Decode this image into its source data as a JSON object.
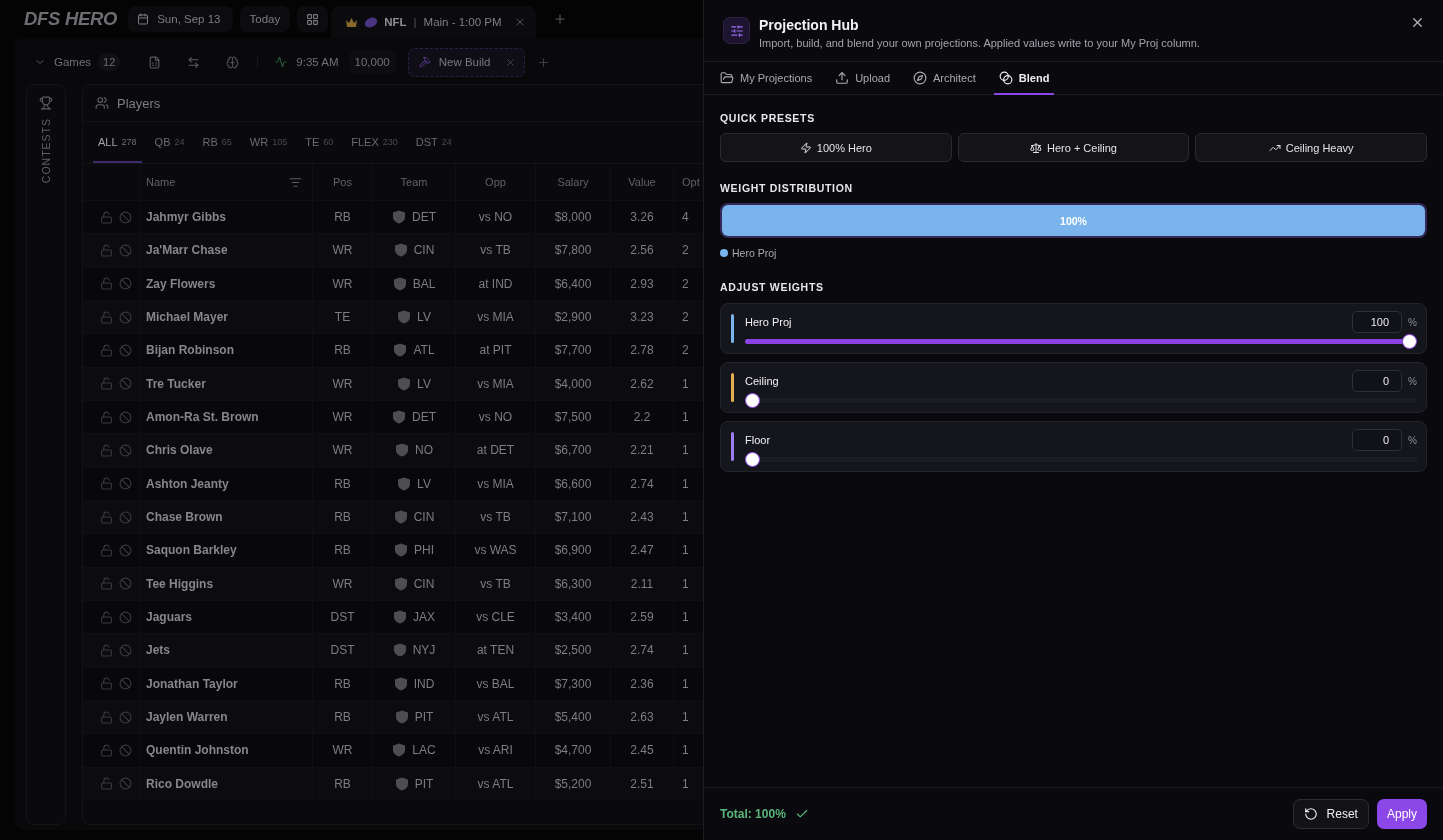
{
  "app_bar": {
    "logo": "DFS HERO",
    "date": "Sun, Sep 13",
    "today_button": "Today",
    "slate_tab": {
      "sport": "NFL",
      "separator": "|",
      "slate": "Main - 1:00 PM"
    }
  },
  "toolbar": {
    "games": {
      "label": "Games",
      "count": "12"
    },
    "time": "9:35 AM",
    "entries": "10,000",
    "build_tab": "New Build"
  },
  "sidebar": {
    "label": "CONTESTS"
  },
  "players": {
    "title": "Players",
    "position_tabs": [
      {
        "label": "ALL",
        "count": "278",
        "selected": true
      },
      {
        "label": "QB",
        "count": "24",
        "selected": false
      },
      {
        "label": "RB",
        "count": "65",
        "selected": false
      },
      {
        "label": "WR",
        "count": "105",
        "selected": false
      },
      {
        "label": "TE",
        "count": "60",
        "selected": false
      },
      {
        "label": "FLEX",
        "count": "230",
        "selected": false
      },
      {
        "label": "DST",
        "count": "24",
        "selected": false
      }
    ],
    "columns": [
      "Name",
      "Pos",
      "Team",
      "Opp",
      "Salary",
      "Value",
      "Opt"
    ],
    "rows": [
      {
        "name": "Jahmyr Gibbs",
        "pos": "RB",
        "team": "DET",
        "opp": "vs NO",
        "salary": "$8,000",
        "value": "3.26",
        "opt": "4"
      },
      {
        "name": "Ja'Marr Chase",
        "pos": "WR",
        "team": "CIN",
        "opp": "vs TB",
        "salary": "$7,800",
        "value": "2.56",
        "opt": "2"
      },
      {
        "name": "Zay Flowers",
        "pos": "WR",
        "team": "BAL",
        "opp": "at IND",
        "salary": "$6,400",
        "value": "2.93",
        "opt": "2"
      },
      {
        "name": "Michael Mayer",
        "pos": "TE",
        "team": "LV",
        "opp": "vs MIA",
        "salary": "$2,900",
        "value": "3.23",
        "opt": "2"
      },
      {
        "name": "Bijan Robinson",
        "pos": "RB",
        "team": "ATL",
        "opp": "at PIT",
        "salary": "$7,700",
        "value": "2.78",
        "opt": "2"
      },
      {
        "name": "Tre Tucker",
        "pos": "WR",
        "team": "LV",
        "opp": "vs MIA",
        "salary": "$4,000",
        "value": "2.62",
        "opt": "1"
      },
      {
        "name": "Amon-Ra St. Brown",
        "pos": "WR",
        "team": "DET",
        "opp": "vs NO",
        "salary": "$7,500",
        "value": "2.2",
        "opt": "1"
      },
      {
        "name": "Chris Olave",
        "pos": "WR",
        "team": "NO",
        "opp": "at DET",
        "salary": "$6,700",
        "value": "2.21",
        "opt": "1"
      },
      {
        "name": "Ashton Jeanty",
        "pos": "RB",
        "team": "LV",
        "opp": "vs MIA",
        "salary": "$6,600",
        "value": "2.74",
        "opt": "1"
      },
      {
        "name": "Chase Brown",
        "pos": "RB",
        "team": "CIN",
        "opp": "vs TB",
        "salary": "$7,100",
        "value": "2.43",
        "opt": "1"
      },
      {
        "name": "Saquon Barkley",
        "pos": "RB",
        "team": "PHI",
        "opp": "vs WAS",
        "salary": "$6,900",
        "value": "2.47",
        "opt": "1"
      },
      {
        "name": "Tee Higgins",
        "pos": "WR",
        "team": "CIN",
        "opp": "vs TB",
        "salary": "$6,300",
        "value": "2.11",
        "opt": "1"
      },
      {
        "name": "Jaguars",
        "pos": "DST",
        "team": "JAX",
        "opp": "vs CLE",
        "salary": "$3,400",
        "value": "2.59",
        "opt": "1"
      },
      {
        "name": "Jets",
        "pos": "DST",
        "team": "NYJ",
        "opp": "at TEN",
        "salary": "$2,500",
        "value": "2.74",
        "opt": "1"
      },
      {
        "name": "Jonathan Taylor",
        "pos": "RB",
        "team": "IND",
        "opp": "vs BAL",
        "salary": "$7,300",
        "value": "2.36",
        "opt": "1"
      },
      {
        "name": "Jaylen Warren",
        "pos": "RB",
        "team": "PIT",
        "opp": "vs ATL",
        "salary": "$5,400",
        "value": "2.63",
        "opt": "1"
      },
      {
        "name": "Quentin Johnston",
        "pos": "WR",
        "team": "LAC",
        "opp": "vs ARI",
        "salary": "$4,700",
        "value": "2.45",
        "opt": "1"
      },
      {
        "name": "Rico Dowdle",
        "pos": "RB",
        "team": "PIT",
        "opp": "vs ATL",
        "salary": "$5,200",
        "value": "2.51",
        "opt": "1"
      }
    ]
  },
  "projection_hub": {
    "title": "Projection Hub",
    "subtitle": "Import, build, and blend your own projections. Applied values write to your My Proj column.",
    "tabs": [
      {
        "label": "My Projections",
        "selected": false
      },
      {
        "label": "Upload",
        "selected": false
      },
      {
        "label": "Architect",
        "selected": false
      },
      {
        "label": "Blend",
        "selected": true
      }
    ],
    "quick_presets": {
      "heading": "QUICK PRESETS",
      "buttons": [
        "100% Hero",
        "Hero + Ceiling",
        "Ceiling Heavy"
      ]
    },
    "weight_distribution": {
      "heading": "WEIGHT DISTRIBUTION",
      "segments": [
        {
          "label": "100%",
          "level": 1,
          "color": "#79b4ec"
        }
      ],
      "legend": [
        {
          "name": "Hero Proj",
          "color": "#79b4ec"
        }
      ]
    },
    "adjust_weights": {
      "heading": "ADJUST WEIGHTS",
      "sources": [
        {
          "name": "Hero Proj",
          "color": "#79b4ec",
          "value": "100",
          "unit": "%",
          "level": 1
        },
        {
          "name": "Ceiling",
          "color": "#e2b04c",
          "value": "0",
          "unit": "%",
          "level": 0
        },
        {
          "name": "Floor",
          "color": "#9d7cf2",
          "value": "0",
          "unit": "%",
          "level": 0
        }
      ]
    },
    "footer": {
      "total": "Total: 100%",
      "valid": true,
      "buttons": [
        {
          "label": "Reset",
          "kind": "secondary"
        },
        {
          "label": "Apply",
          "kind": "primary"
        }
      ]
    }
  }
}
